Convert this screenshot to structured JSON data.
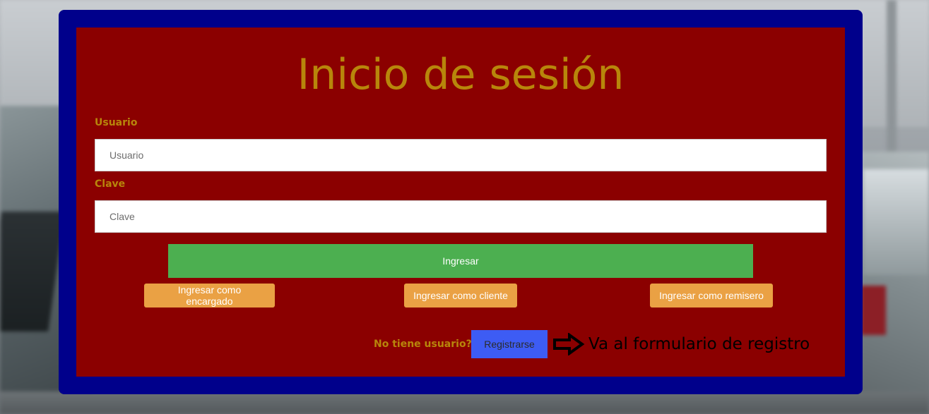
{
  "login": {
    "title": "Inicio de sesión",
    "username": {
      "label": "Usuario",
      "placeholder": "Usuario",
      "value": ""
    },
    "password": {
      "label": "Clave",
      "placeholder": "Clave",
      "value": ""
    },
    "submit_label": "Ingresar",
    "role_buttons": {
      "encargado": "Ingresar como encargado",
      "cliente": "Ingresar como cliente",
      "remisero": "Ingresar como remisero"
    },
    "no_account_text": "No tiene usuario?",
    "register_label": "Registrarse",
    "register_hint": "Va al formulario de registro",
    "register_hint_icon": "right-arrow-icon"
  },
  "colors": {
    "outer_frame": "#00008b",
    "card_background": "#8b0000",
    "title_text": "#b8860b",
    "submit_button": "#4caf50",
    "role_buttons": "#eaa144",
    "register_button": "#3d5cf4"
  }
}
